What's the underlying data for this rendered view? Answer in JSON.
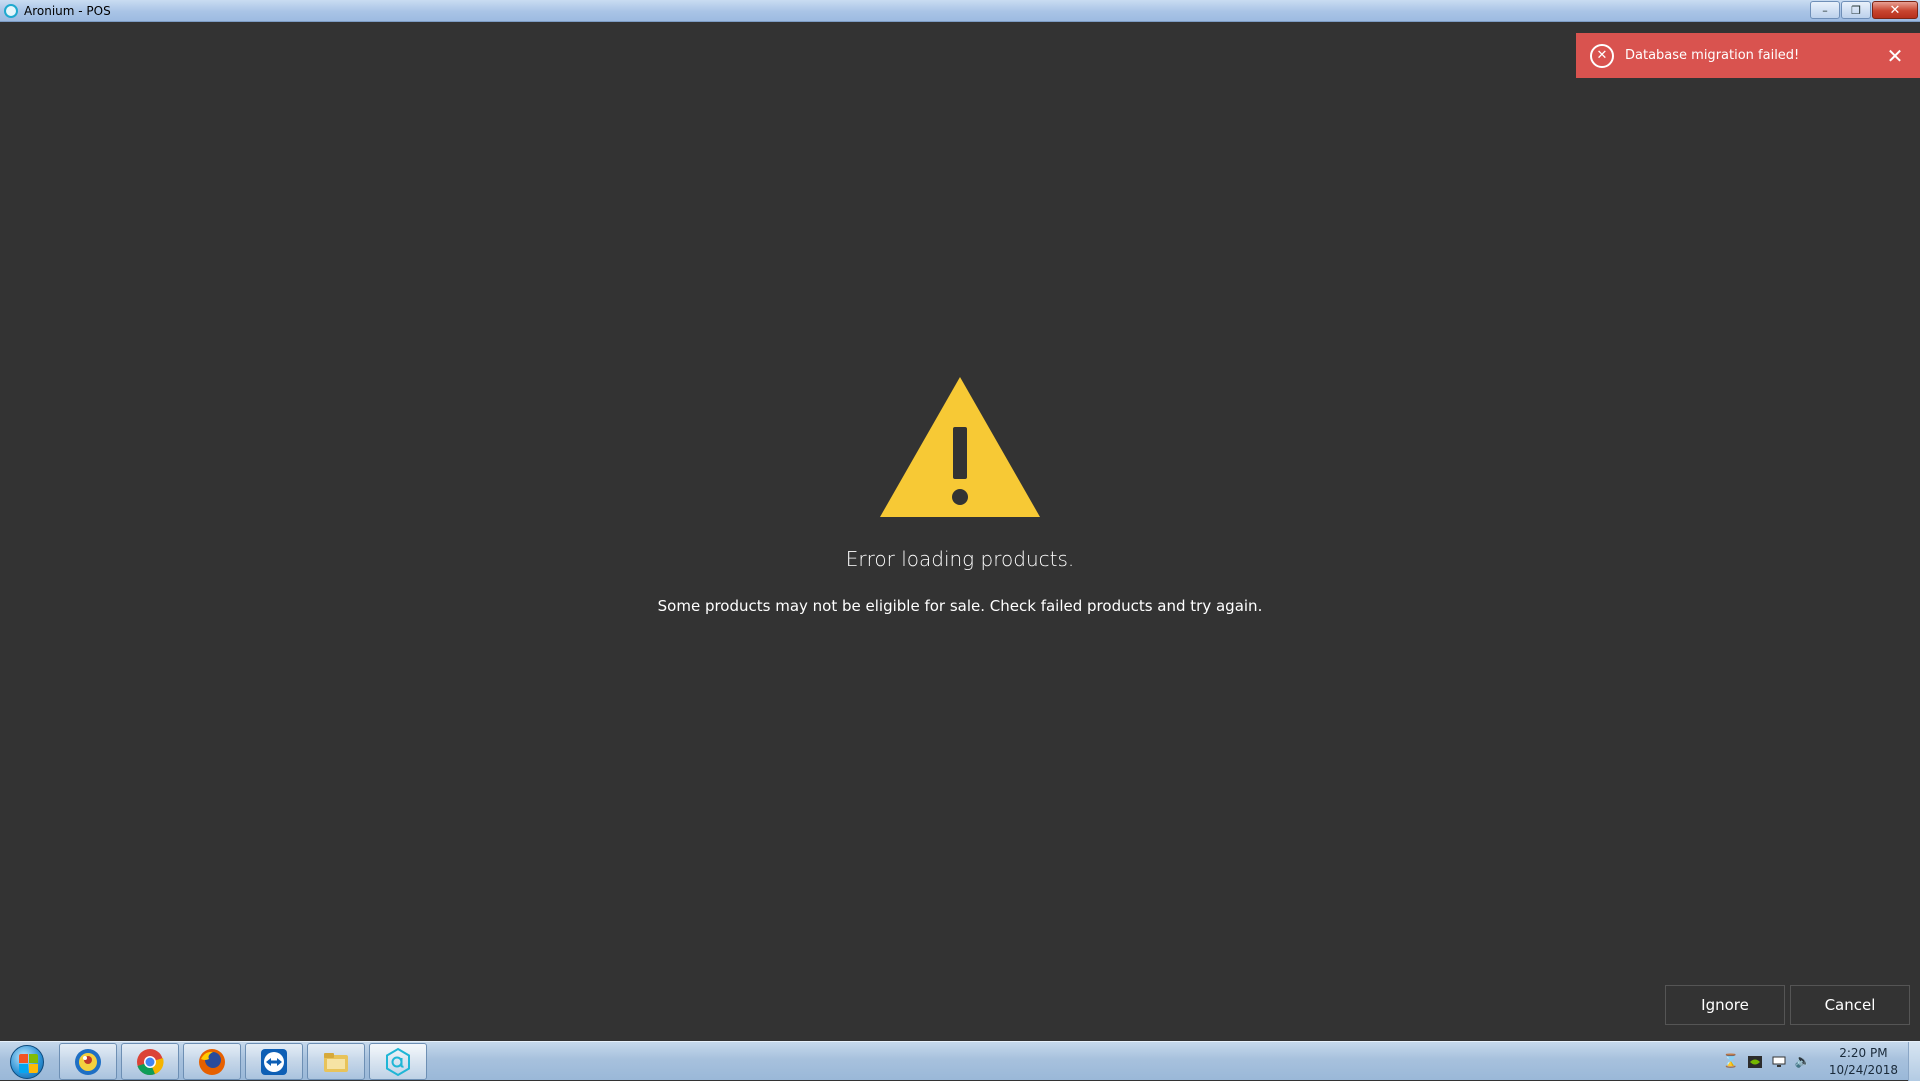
{
  "window": {
    "title": "Aronium - POS",
    "controls": {
      "minimize": "–",
      "restore": "❐",
      "close": "✕"
    }
  },
  "toast": {
    "message": "Database migration failed!",
    "icon": "x-circle-icon",
    "close_glyph": "✕",
    "color": "#d9534f"
  },
  "error": {
    "icon": "warning-triangle-icon",
    "icon_color": "#f7c935",
    "title": "Error loading products.",
    "description": "Some products may not be eligible for sale. Check failed products and try again."
  },
  "buttons": {
    "ignore_label": "Ignore",
    "cancel_label": "Cancel"
  },
  "taskbar": {
    "items": [
      "start-orb-icon",
      "browser-pinned-icon",
      "chrome-icon",
      "firefox-icon",
      "teamviewer-icon",
      "file-explorer-icon",
      "aronium-icon"
    ],
    "tray_icons": [
      "hourglass-icon",
      "nvidia-icon",
      "network-icon",
      "volume-icon"
    ],
    "clock_time": "2:20 PM",
    "clock_date": "10/24/2018"
  }
}
